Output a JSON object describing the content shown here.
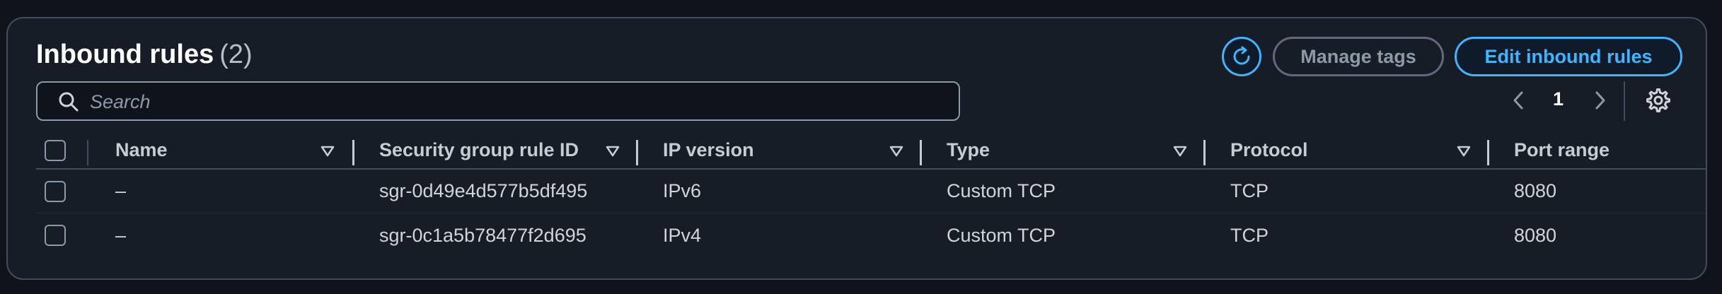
{
  "header": {
    "title": "Inbound rules",
    "count": "(2)"
  },
  "actions": {
    "refresh_icon": "refresh-icon",
    "manage_tags_label": "Manage tags",
    "edit_inbound_rules_label": "Edit inbound rules"
  },
  "search": {
    "placeholder": "Search",
    "value": ""
  },
  "pagination": {
    "current_page": "1"
  },
  "table": {
    "columns": [
      "Name",
      "Security group rule ID",
      "IP version",
      "Type",
      "Protocol",
      "Port range"
    ],
    "rows": [
      [
        "–",
        "sgr-0d49e4d577b5df495",
        "IPv6",
        "Custom TCP",
        "TCP",
        "8080"
      ],
      [
        "–",
        "sgr-0c1a5b78477f2d695",
        "IPv4",
        "Custom TCP",
        "TCP",
        "8080"
      ]
    ]
  },
  "colors": {
    "accent": "#42b4ff",
    "panel_bg": "#161d26",
    "border": "#414d5c"
  }
}
